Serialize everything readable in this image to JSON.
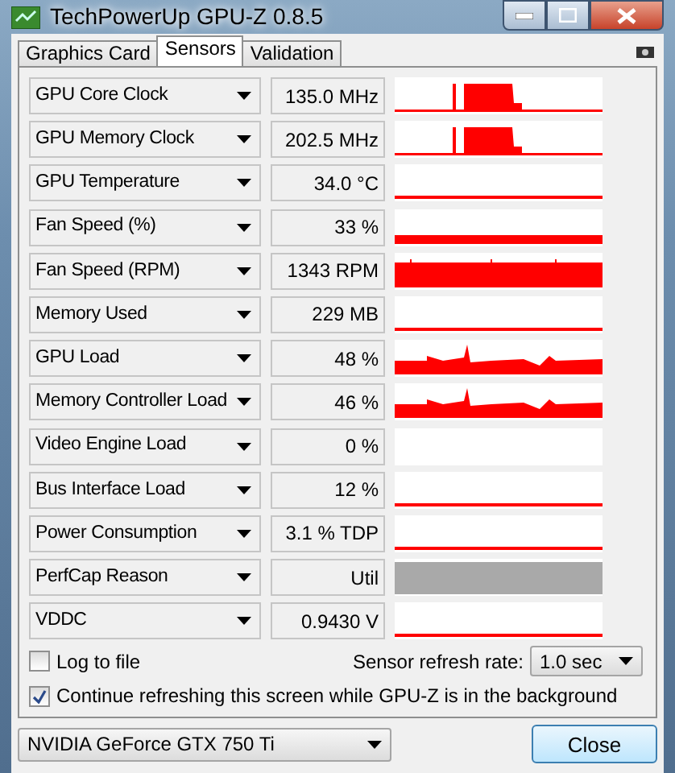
{
  "window": {
    "title": "TechPowerUp GPU-Z 0.8.5"
  },
  "tabs": [
    {
      "label": "Graphics Card",
      "selected": false
    },
    {
      "label": "Sensors",
      "selected": true
    },
    {
      "label": "Validation",
      "selected": false
    }
  ],
  "sensors": [
    {
      "name": "GPU Core Clock",
      "value": "135.0 MHz",
      "kind": "burst"
    },
    {
      "name": "GPU Memory Clock",
      "value": "202.5 MHz",
      "kind": "burst"
    },
    {
      "name": "GPU Temperature",
      "value": "34.0 °C",
      "kind": "baseline"
    },
    {
      "name": "Fan Speed (%)",
      "value": "33 %",
      "kind": "band"
    },
    {
      "name": "Fan Speed (RPM)",
      "value": "1343 RPM",
      "kind": "high"
    },
    {
      "name": "Memory Used",
      "value": "229 MB",
      "kind": "baseline"
    },
    {
      "name": "GPU Load",
      "value": "48 %",
      "kind": "noisy"
    },
    {
      "name": "Memory Controller Load",
      "value": "46 %",
      "kind": "noisy"
    },
    {
      "name": "Video Engine Load",
      "value": "0 %",
      "kind": "empty"
    },
    {
      "name": "Bus Interface Load",
      "value": "12 %",
      "kind": "baseline"
    },
    {
      "name": "Power Consumption",
      "value": "3.1 % TDP",
      "kind": "baseline"
    },
    {
      "name": "PerfCap Reason",
      "value": "Util",
      "kind": "shaded"
    },
    {
      "name": "VDDC",
      "value": "0.9430 V",
      "kind": "baseline"
    }
  ],
  "log_to_file": {
    "label": "Log to file",
    "checked": false
  },
  "refresh_rate": {
    "label": "Sensor refresh rate:",
    "value": "1.0 sec"
  },
  "continue_refreshing": {
    "label": "Continue refreshing this screen while GPU-Z is in the background",
    "checked": true
  },
  "gpu_select": {
    "value": "NVIDIA GeForce GTX 750 Ti"
  },
  "close_button": {
    "label": "Close"
  }
}
